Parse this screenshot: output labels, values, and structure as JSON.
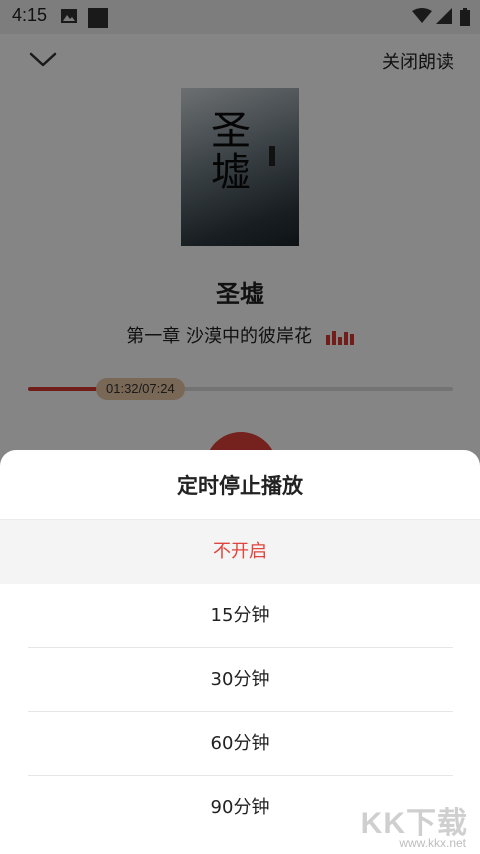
{
  "status_bar": {
    "time": "4:15"
  },
  "header": {
    "close_read_label": "关闭朗读"
  },
  "book": {
    "cover_text": "圣墟",
    "title": "圣墟",
    "chapter": "第一章 沙漠中的彼岸花"
  },
  "player": {
    "progress_label": "01:32/07:24",
    "progress_fraction": 0.207
  },
  "sheet": {
    "title": "定时停止播放",
    "options": [
      {
        "label": "不开启",
        "selected": true
      },
      {
        "label": "15分钟",
        "selected": false
      },
      {
        "label": "30分钟",
        "selected": false
      },
      {
        "label": "60分钟",
        "selected": false
      },
      {
        "label": "90分钟",
        "selected": false
      }
    ]
  },
  "watermark": {
    "main": "KK下载",
    "sub": "www.kkx.net"
  },
  "colors": {
    "accent": "#e0443c",
    "progress": "#d93a35",
    "thumb": "#e8c7a6"
  }
}
